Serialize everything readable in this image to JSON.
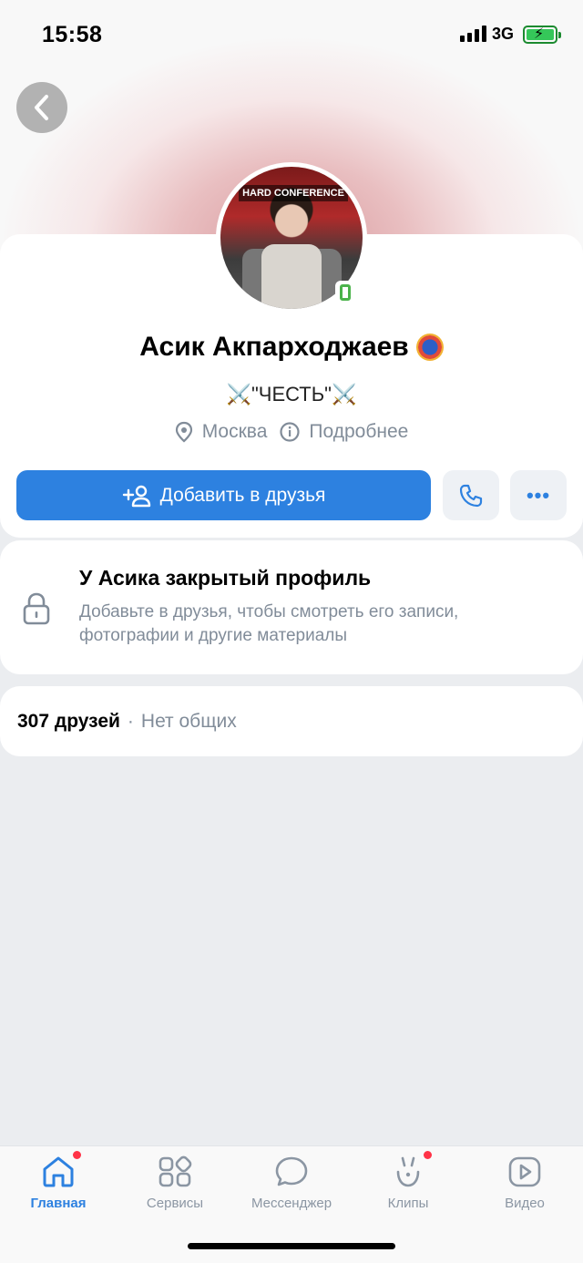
{
  "status_bar": {
    "time": "15:58",
    "network": "3G"
  },
  "profile": {
    "name": "Асик Акпарходжаев",
    "status": "⚔️\"ЧЕСТЬ\"⚔️",
    "city": "Москва",
    "details_label": "Подробнее",
    "avatar_banner": "HARD CONFERENCE"
  },
  "actions": {
    "add_friend_label": "Добавить в друзья",
    "more_label": "•••"
  },
  "private_profile": {
    "title": "У Асика закрытый профиль",
    "text": "Добавьте в друзья, чтобы смотреть его записи, фотографии и другие материалы"
  },
  "friends": {
    "count": "307 друзей",
    "separator": "·",
    "common": "Нет общих"
  },
  "tabbar": {
    "items": [
      {
        "label": "Главная",
        "icon": "home-icon",
        "active": true,
        "badge": true
      },
      {
        "label": "Сервисы",
        "icon": "services-icon",
        "active": false,
        "badge": false
      },
      {
        "label": "Мессенджер",
        "icon": "messenger-icon",
        "active": false,
        "badge": false
      },
      {
        "label": "Клипы",
        "icon": "clips-icon",
        "active": false,
        "badge": true
      },
      {
        "label": "Видео",
        "icon": "video-icon",
        "active": false,
        "badge": false
      }
    ]
  },
  "colors": {
    "accent": "#2d81e0",
    "badge": "#ff3347",
    "online": "#4bb34b"
  }
}
